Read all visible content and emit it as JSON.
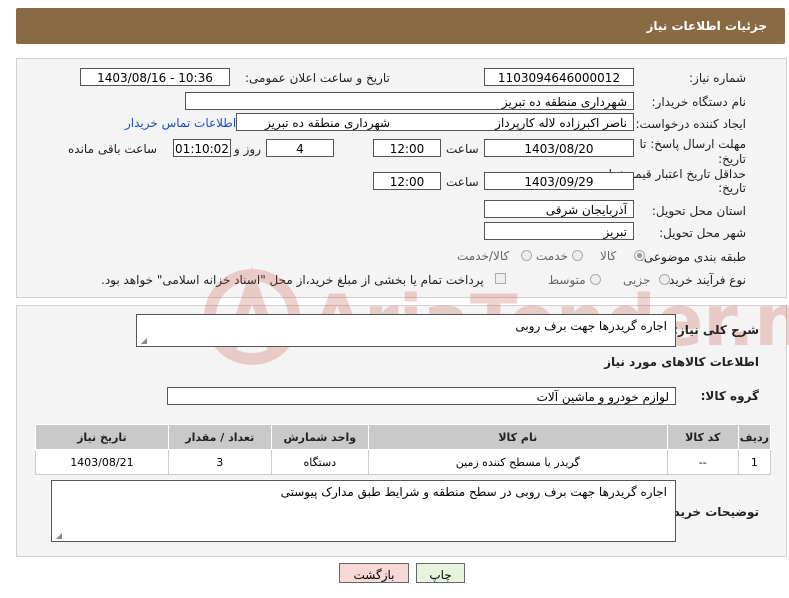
{
  "header": {
    "title": "جزئیات اطلاعات نیاز"
  },
  "form": {
    "need_number_label": "شماره نیاز:",
    "need_number": "1103094646000012",
    "announce_label": "تاریخ و ساعت اعلان عمومی:",
    "announce_value": "1403/08/16 - 10:36",
    "buyer_org_label": "نام دستگاه خریدار:",
    "buyer_org": "شهرداری منطقه ده تبریز",
    "creator_label": "ایجاد کننده درخواست:",
    "creator": "ناصر اکبرزاده لاله کارپرداز",
    "creator_org": "شهرداری منطقه ده تبریز",
    "contact_link": "اطلاعات تماس خریدار",
    "reply_deadline_label": "مهلت ارسال پاسخ: تا",
    "reply_deadline_label2": "تاریخ:",
    "reply_date": "1403/08/20",
    "time_label": "ساعت",
    "reply_time": "12:00",
    "days_value": "4",
    "days_label": "روز و",
    "remaining_time": "01:10:02",
    "remaining_label": "ساعت باقی مانده",
    "price_deadline_label": "حداقل تاریخ اعتبار قیمت: تا",
    "price_deadline_label2": "تاریخ:",
    "price_date": "1403/09/29",
    "price_time": "12:00",
    "province_label": "استان محل تحویل:",
    "province": "آذربایجان شرقی",
    "city_label": "شهر محل تحویل:",
    "city": "تبریز",
    "category_label": "طبقه بندی موضوعی:",
    "category_options": [
      "کالا",
      "خدمت",
      "کالا/خدمت"
    ],
    "process_label": "نوع فرآیند خرید :",
    "process_options": [
      "جزیی",
      "متوسط"
    ],
    "payment_note": "پرداخت تمام یا بخشی از مبلغ خرید،از محل \"اسناد خزانه اسلامی\" خواهد بود."
  },
  "details": {
    "summary_label": "شرح کلی نیاز:",
    "summary": "اجاره گریدرها جهت برف روبی",
    "goods_info_title": "اطلاعات کالاهای مورد نیاز",
    "goods_group_label": "گروه کالا:",
    "goods_group": "لوازم خودرو و ماشین آلات",
    "table": {
      "headers": [
        "ردیف",
        "کد کالا",
        "نام کالا",
        "واحد شمارش",
        "تعداد / مقدار",
        "تاریخ نیاز"
      ],
      "rows": [
        [
          "1",
          "--",
          "گریدر یا مسطح کننده زمین",
          "دستگاه",
          "3",
          "1403/08/21"
        ]
      ]
    },
    "buyer_notes_label": "توضیحات خریدار:",
    "buyer_notes": "اجاره گریدرها جهت برف روبی در سطح منطقه و شرایط طبق مدارک پیوستی"
  },
  "buttons": {
    "print": "چاپ",
    "back": "بازگشت"
  },
  "watermark": {
    "text": "AriaTender.net"
  },
  "colors": {
    "title_bar": "#8a6a42",
    "link": "#1a4ec9",
    "back_button": "#f8d7d7",
    "print_button": "#e6f4dc"
  }
}
